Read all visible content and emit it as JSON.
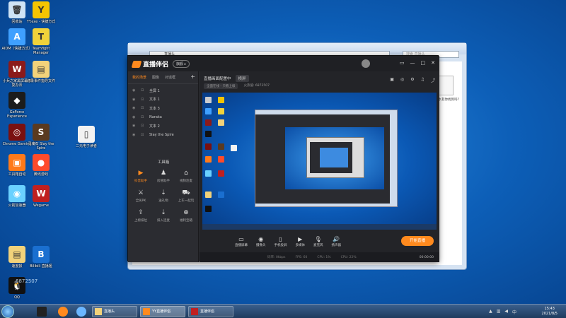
{
  "desktop": {
    "icons": [
      {
        "label": "回收站",
        "color": "#cfe3f5",
        "glyph": "🗑"
      },
      {
        "label": "YY.exe - 快捷方式",
        "color": "#f4c400",
        "glyph": "Y"
      },
      {
        "label": "AIDM（快捷方式）",
        "color": "#3fa0ff",
        "glyph": "A"
      },
      {
        "label": "Teamfight Manager",
        "color": "#f0d23a",
        "glyph": "T"
      },
      {
        "label": "小兵之家黑屏幕修复办法",
        "color": "#8b1a1a",
        "glyph": "W"
      },
      {
        "label": "灯录事件指导文件",
        "color": "#f2d27a",
        "glyph": "▤"
      },
      {
        "label": "GeForce Experience",
        "color": "#1c1c1c",
        "glyph": "◆"
      },
      {
        "label": "Chrome Gaming",
        "color": "#7a1010",
        "glyph": "◎"
      },
      {
        "label": "灵魂石 Slay the Spire",
        "color": "#5a3a20",
        "glyph": "S"
      },
      {
        "label": "二元电子读者",
        "color": "#f2f2f2",
        "glyph": "▯"
      },
      {
        "label": "工具箱自动",
        "color": "#ff7a1a",
        "glyph": "▣"
      },
      {
        "label": "腾讯游戏",
        "color": "#ff4b2b",
        "glyph": "●"
      },
      {
        "label": "火箭加速器",
        "color": "#6ad1ff",
        "glyph": "◉"
      },
      {
        "label": "Wegame",
        "color": "#c02020",
        "glyph": "W"
      },
      {
        "label": "速度报",
        "color": "#f2d27a",
        "glyph": "▤"
      },
      {
        "label": "Bilibili 直播姬",
        "color": "#1a6fd0",
        "glyph": "B"
      },
      {
        "label": "QQ",
        "color": "#111",
        "glyph": "🐧"
      }
    ]
  },
  "explorer": {
    "address": "直播头",
    "search_placeholder": "搜索 直播头",
    "file_label": "一键 水友你找到吗？"
  },
  "app": {
    "title": "直播伴侣",
    "version_chip": "旗舰 ▸",
    "window_buttons": [
      "▭",
      "—",
      "□",
      "✕"
    ],
    "left_tabs": [
      "我的场景",
      "图像",
      "对话框"
    ],
    "add_label": "+",
    "scenes": [
      "全屏 1",
      "文本 1",
      "文本 3",
      "Naraka",
      "文本 2",
      "Slay the Spire"
    ],
    "tools_title": "工具箱",
    "tools": [
      {
        "label": "抖音助手",
        "icon": "▶",
        "hot": true
      },
      {
        "label": "房管助手",
        "icon": "♟",
        "hot": false
      },
      {
        "label": "视频连麦",
        "icon": "⌂",
        "hot": false
      },
      {
        "label": "全民PK",
        "icon": "⚔",
        "hot": false
      },
      {
        "label": "送礼物",
        "icon": "⇣",
        "hot": false
      },
      {
        "label": "上车一起玩",
        "icon": "⛟",
        "hot": false
      },
      {
        "label": "上榜排位",
        "icon": "⇪",
        "hot": false
      },
      {
        "label": "排入连麦",
        "icon": "⇣",
        "hot": false
      },
      {
        "label": "福利宝箱",
        "icon": "⊕",
        "hot": false
      }
    ],
    "main": {
      "scene_title": "直播画面配置中",
      "chip": "横屏",
      "sub_items": [
        "全面在线 - 只看上级",
        "火热值: 6872507"
      ],
      "toolbar": [
        {
          "label": "直播屏幕",
          "icon": "▭"
        },
        {
          "label": "摄像头",
          "icon": "◉"
        },
        {
          "label": "手机投屏",
          "icon": "▯"
        },
        {
          "label": "多媒体",
          "icon": "▶"
        },
        {
          "label": "麦克风",
          "icon": "🎙"
        },
        {
          "label": "扬声器",
          "icon": "🔊"
        }
      ],
      "go_live": "开始直播",
      "status": [
        "码率: 0kbps",
        "FPS: 60",
        "CPU: 1%",
        "CPU: 22%"
      ],
      "time": "00:00:00"
    }
  },
  "taskbar": {
    "tasks": [
      "直播头",
      "YY直播伴侣",
      "直播伴侣"
    ],
    "time": "15:43",
    "date": "2021/8/5"
  },
  "watermark": "6872507"
}
